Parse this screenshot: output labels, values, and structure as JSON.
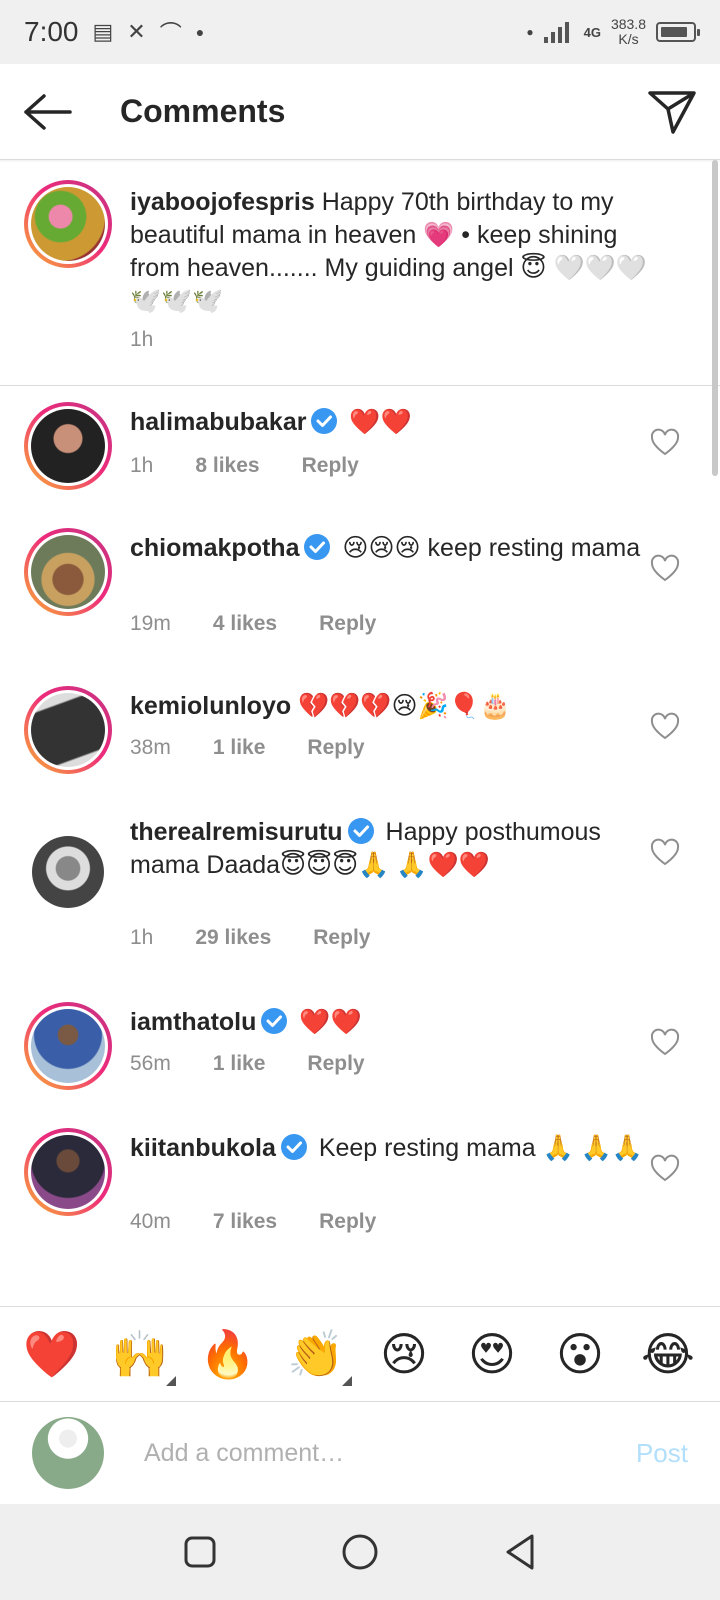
{
  "status_bar": {
    "time": "7:00",
    "net_speed_value": "383.8",
    "net_speed_unit": "K/s",
    "network_tag": "4G"
  },
  "header": {
    "title": "Comments",
    "back_icon": "arrow-left-icon",
    "send_icon": "paper-plane-icon"
  },
  "caption": {
    "username": "iyaboojofespris",
    "text": " Happy 70th birthday to my beautiful mama in heaven 💗 • keep shining from heaven....... My guiding angel 😇 🤍🤍🤍🕊️🕊️🕊️",
    "time": "1h"
  },
  "comments": [
    {
      "username": "halimabubakar",
      "verified": true,
      "text": " ❤️❤️",
      "time": "1h",
      "likes": "8 likes",
      "reply": "Reply"
    },
    {
      "username": "chiomakpotha",
      "verified": true,
      "text": " 😢😢😢 keep resting mama",
      "time": "19m",
      "likes": "4 likes",
      "reply": "Reply"
    },
    {
      "username": "kemiolunloyo",
      "verified": false,
      "text": " 💔💔💔😢🎉🎈🎂",
      "time": "38m",
      "likes": "1 like",
      "reply": "Reply"
    },
    {
      "username": "therealremisurutu",
      "verified": true,
      "text": " Happy posthumous mama Daada😇😇😇🙏 🙏❤️❤️",
      "time": "1h",
      "likes": "29 likes",
      "reply": "Reply"
    },
    {
      "username": "iamthatolu",
      "verified": true,
      "text": " ❤️❤️",
      "time": "56m",
      "likes": "1 like",
      "reply": "Reply"
    },
    {
      "username": "kiitanbukola",
      "verified": true,
      "text": " Keep resting mama 🙏 🙏🙏",
      "time": "40m",
      "likes": "7 likes",
      "reply": "Reply"
    }
  ],
  "quick_reactions": [
    "❤️",
    "🙌",
    "🔥",
    "👏",
    "😢",
    "😍",
    "😮",
    "😂"
  ],
  "composer": {
    "placeholder": "Add a comment…",
    "post_label": "Post"
  },
  "colors": {
    "verified_blue": "#3897f0",
    "post_disabled": "#b2dffc",
    "meta_gray": "#8e8e8e"
  }
}
